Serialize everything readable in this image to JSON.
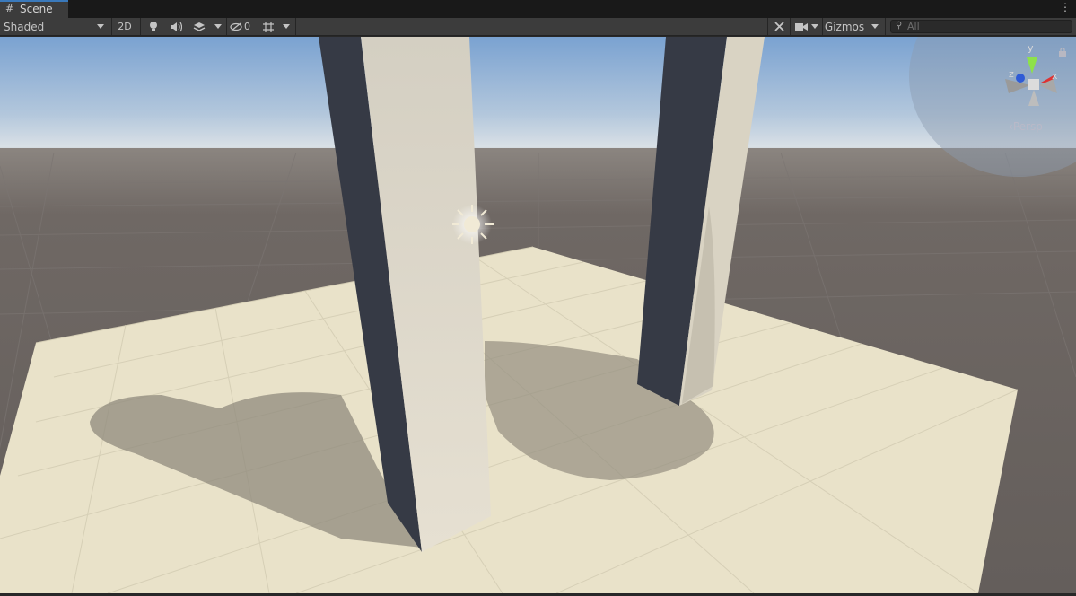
{
  "tab": {
    "icon": "grid-hash-icon",
    "label": "Scene"
  },
  "window_menu_icon": "kebab-menu-icon",
  "toolbar": {
    "draw_mode": "Shaded",
    "toggle_2d": "2D",
    "lighting_icon": "lightbulb-icon",
    "audio_icon": "speaker-icon",
    "effects_icon": "layers-icon",
    "hidden_icon": "eye-slash-icon",
    "hidden_count": "0",
    "grid_icon": "grid-icon",
    "tools_icon": "tools-icon",
    "camera_icon": "camera-icon",
    "gizmos_label": "Gizmos",
    "search_placeholder": "All"
  },
  "orientation_gizmo": {
    "axis_y": "y",
    "axis_x": "x",
    "axis_z": "z",
    "projection": "Persp",
    "lock_icon": "lock-icon"
  },
  "colors": {
    "sky_top": "#7aa2d1",
    "horizon": "#d9e0e6",
    "ground": "#6d6663",
    "plane": "#e9e2c9",
    "pillar_light": "#e3ddcf",
    "pillar_dark": "#383c48",
    "accent": "#3a79bb"
  }
}
